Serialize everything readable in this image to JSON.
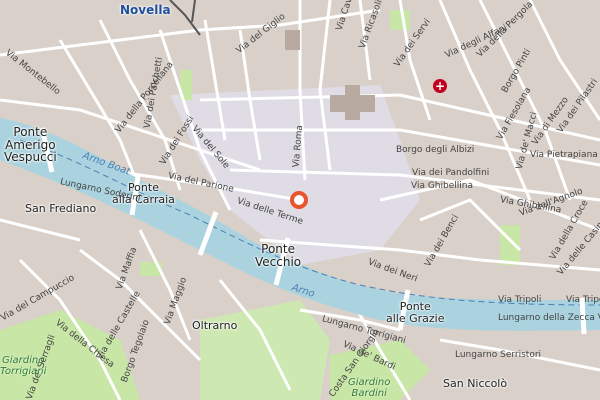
{
  "colors": {
    "water": "#aad3df",
    "street": "#ffffff",
    "block": "#d9d0c9",
    "pedestrian": "#dddde8",
    "park": "#c8e6a6",
    "hospital": "#c0001f",
    "marker": "#e8552d",
    "rail": "#555555"
  },
  "icons": {
    "hospital": "hospital-cross-icon",
    "marker": "location-marker-icon"
  },
  "places": {
    "novella": "Novella",
    "ponte_amerigo": "Ponte\nAmerigo\nVespucci",
    "ponte_carraia": "Ponte\nalla Carraia",
    "san_frediano": "San Frediano",
    "ponte_vecchio": "Ponte\nVecchio",
    "oltrarno": "Oltrarno",
    "ponte_grazie": "Ponte\nalle Grazie",
    "san_niccolo": "San Niccolò"
  },
  "parks": {
    "torrigiani": "Giardino\nTorrigiani",
    "bardini": "Giardino\nBardini"
  },
  "water": {
    "arno_boat": "Arno Boat",
    "arno": "Arno"
  },
  "streets": {
    "montebello": "Via Montebello",
    "porcellana": "Via della Porcellana",
    "giglio": "Via del Giglio",
    "fossi": "Via dei Fossi",
    "sole": "Via del Sole",
    "palchetti": "Via dei Palchetti",
    "parione": "Via del Parione",
    "terme": "Via delle Terme",
    "roma": "Via Roma",
    "ricasoli": "Via Ricasoli",
    "servi": "Via dei Servi",
    "cavour": "Via Cavour",
    "alfani": "Via degli Alfani",
    "pergola": "Via della Pergola",
    "borgo_pinti": "Borgo Pinti",
    "fiesolana": "Via Fiesolana",
    "mezzo": "Via di Mezzo",
    "pilastri": "Via dei Pilastri",
    "albizi": "Borgo degli Albizi",
    "pandolfini": "Via dei Pandolfini",
    "ghibellina": "Via Ghibellina",
    "ghibellina2": "Via Ghibellina",
    "agnolo": "Via dell'Agnolo",
    "pietrapiana": "Via Pietrapiana",
    "macci": "Via de' Macci",
    "croce": "Via della Croce",
    "casine": "Via delle Casine",
    "lungarno_soderini": "Lungarno Soderini",
    "maffia": "Via Maffia",
    "campuccio": "Via del Campuccio",
    "chiesa": "Via della Chiesa",
    "serragli": "Via de' Serragli",
    "maggio": "Via Maggio",
    "castelle": "Via delle Castelle",
    "borgo_tegolaio": "Borgo Tegolaio",
    "neri": "Via dei Neri",
    "benci": "Via dei Benci",
    "lungarno_torrigiani": "Lungarno Torrigiani",
    "bardi": "Via de' Bardi",
    "tripoli": "Via Tripoli",
    "tripoli2": "Via Tripoli",
    "lungarno_zecca": "Lungarno della Zecca Vecchia",
    "lungarno_serristori": "Lungarno Serristori",
    "san_giorgio": "Costa San Giorgio"
  }
}
